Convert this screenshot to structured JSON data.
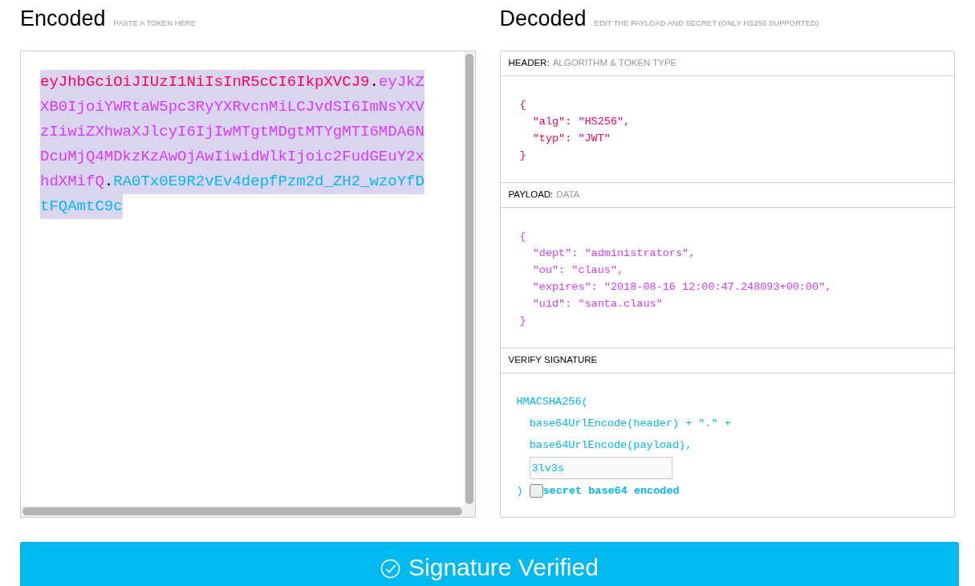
{
  "encoded": {
    "title": "Encoded",
    "hint": "PASTE A TOKEN HERE",
    "selected": true,
    "token_lines": [
      [
        {
          "kind": "header",
          "text": "eyJhbGciOiJIUzI1NiIsInR5cCI6IkpXVCJ9"
        },
        {
          "kind": "dot",
          "text": "."
        },
        {
          "kind": "payload",
          "text": "eyJkZ"
        }
      ],
      [
        {
          "kind": "payload",
          "text": "XB0IjoiYWRtaW5pc3RyYXRvcnMiLCJvdSI6ImNsYXV"
        }
      ],
      [
        {
          "kind": "payload",
          "text": "zIiwiZXhwaXJlcyI6IjIwMTgtMDgtMTYgMTI6MDA6N"
        }
      ],
      [
        {
          "kind": "payload",
          "text": "DcuMjQ4MDkzKzAwOjAwIiwidWlkIjoic2FudGEuY2x"
        }
      ],
      [
        {
          "kind": "payload",
          "text": "hdXMifQ"
        },
        {
          "kind": "dot",
          "text": "."
        },
        {
          "kind": "signature",
          "text": "RA0Tx0E9R2vEv4depfPzm2d_ZH2_wzoYfD"
        }
      ],
      [
        {
          "kind": "signature",
          "text": "tFQAmtC9c"
        }
      ]
    ]
  },
  "decoded": {
    "title": "Decoded",
    "hint": "EDIT THE PAYLOAD AND SECRET (ONLY HS256 SUPPORTED)",
    "header": {
      "label": "HEADER:",
      "sublabel": "ALGORITHM & TOKEN TYPE",
      "lines": [
        "{",
        "  \"alg\": \"HS256\",",
        "  \"typ\": \"JWT\"",
        "}"
      ]
    },
    "payload": {
      "label": "PAYLOAD:",
      "sublabel": "DATA",
      "lines": [
        "{",
        "  \"dept\": \"administrators\",",
        "  \"ou\": \"claus\",",
        "  \"expires\": \"2018-08-16 12:00:47.248093+00:00\",",
        "  \"uid\": \"santa.claus\"",
        "}"
      ]
    },
    "signature": {
      "label": "VERIFY SIGNATURE",
      "lines": [
        "HMACSHA256(",
        "  base64UrlEncode(header) + \".\" +",
        "  base64UrlEncode(payload),"
      ],
      "secret": "3lv3s",
      "close": ")",
      "checkbox_label": "secret base64 encoded",
      "checked": false
    }
  },
  "status_button": {
    "label": "Signature Verified"
  }
}
